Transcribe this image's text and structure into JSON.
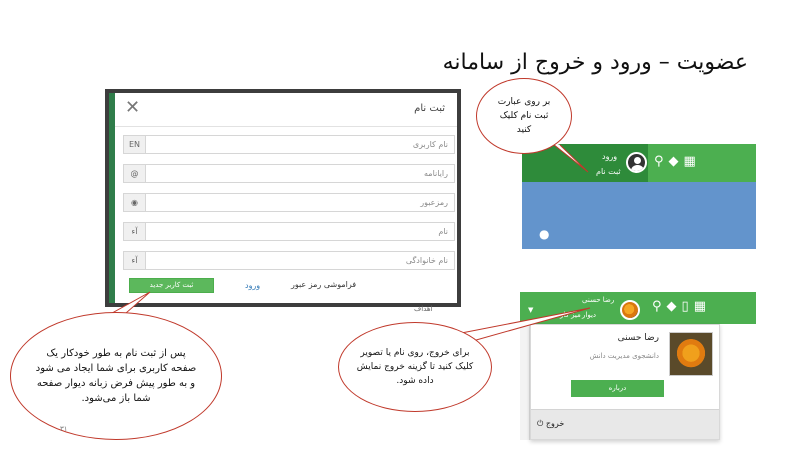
{
  "slide": {
    "title": "عضویت – ورود و خروج از سامانه",
    "page_number": "۳۱",
    "peek_text": "اهداف"
  },
  "register_modal": {
    "title": "ثبت نام",
    "close_icon": "close-icon",
    "fields": [
      {
        "placeholder": "نام کاربری",
        "addon": "EN"
      },
      {
        "placeholder": "رایانامه",
        "addon": "@"
      },
      {
        "placeholder": "رمزعبور",
        "addon": "eye-icon"
      },
      {
        "placeholder": "نام",
        "addon": "آء"
      },
      {
        "placeholder": "نام خانوادگی",
        "addon": "آء"
      }
    ],
    "register_button": "ثبت کاربر جدید",
    "login_link": "ورود",
    "forgot_link": "فراموشی رمز عبور"
  },
  "widget_top": {
    "login": "ورود",
    "register": "ثبت نام",
    "icons": [
      "search-icon",
      "tag-icon",
      "grid-icon"
    ],
    "colors": {
      "bar": "#4caf50",
      "user_zone": "#2e8b3a",
      "body": "#6394cc"
    }
  },
  "widget_bottom": {
    "name": "رضا حسنی",
    "sub_wall": "دیوار",
    "sub_desk": "میز کار",
    "icons": [
      "search-icon",
      "tag-icon",
      "grid-icon",
      "book-icon"
    ],
    "dropdown": {
      "name": "رضا حسنی",
      "role": "دانشجوی مدیریت دانش",
      "about_button": "درباره",
      "logout": "خروج"
    }
  },
  "callouts": {
    "top": [
      "بر روی عبارت",
      "ثبت نام کلیک",
      "کنید"
    ],
    "left": "پس از ثبت نام به طور خودکار یک صفحه کاربری برای شما ایجاد می شود و به طور پیش فرض زبانه دیوار صفحه شما باز می‌شود.",
    "middle": "برای خروج، روی نام یا تصویر کلیک کنید تا گزینه خروج نمایش داده شود."
  }
}
